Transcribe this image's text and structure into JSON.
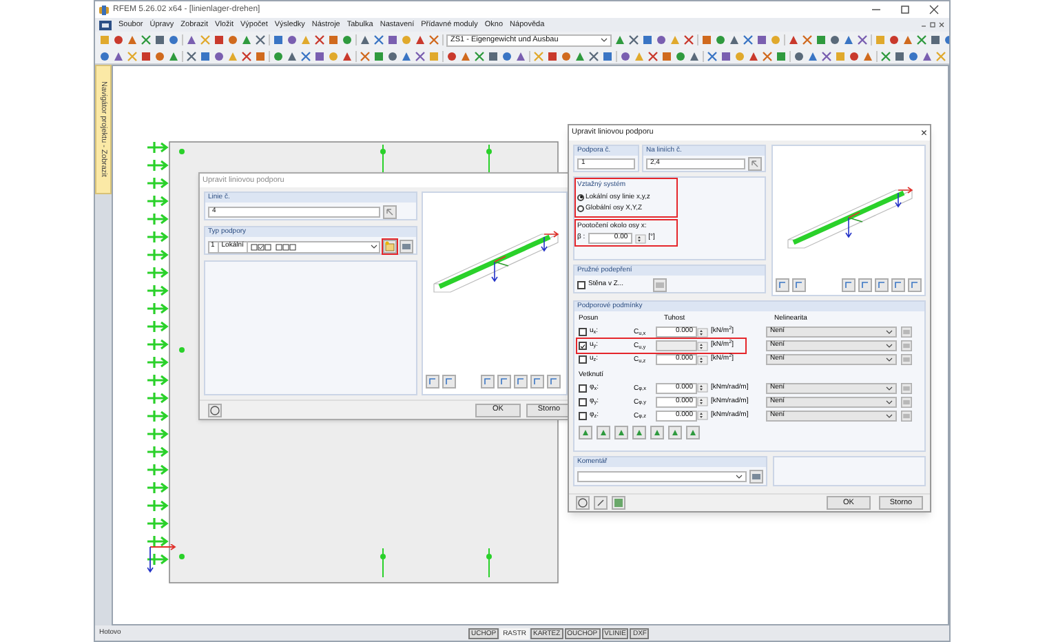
{
  "window": {
    "title": "RFEM 5.26.02 x64 - [linienlager-drehen]"
  },
  "menu": [
    "Soubor",
    "Úpravy",
    "Zobrazit",
    "Vložit",
    "Výpočet",
    "Výsledky",
    "Nástroje",
    "Tabulka",
    "Nastavení",
    "Přídavné moduly",
    "Okno",
    "Nápověda"
  ],
  "toolbar": {
    "load_case": "ZS1 - Eigengewicht und Ausbau"
  },
  "navigator_tab": {
    "label": "Navigátor projektu - Zobrazit"
  },
  "dialog_back": {
    "title": "Upravit liniovou podporu",
    "line_label": "Linie č.",
    "line_value": "4",
    "support_type_label": "Typ podpory",
    "support_number": "1",
    "support_system": "Lokální",
    "new_button_highlighted": true,
    "buttons": [
      "OK",
      "Storno"
    ]
  },
  "dialog_front": {
    "title": "Upravit liniovou podporu",
    "close": "×",
    "support_label": "Podpora č.",
    "support_value": "1",
    "lines_label": "Na liniích č.",
    "lines_value": "2,4",
    "reference": {
      "label": "Vztažný systém",
      "highlighted": true,
      "options": [
        {
          "label": "Lokální osy linie x,y,z",
          "selected": true
        },
        {
          "label": "Globální osy X,Y,Z",
          "selected": false
        }
      ]
    },
    "rotation": {
      "label": "Pootočení okolo osy x:",
      "symbol": "β :",
      "value": "0.00",
      "unit": "[°]",
      "highlighted": true
    },
    "elastic": {
      "label": "Pružné podepření",
      "checkbox": "Stěna v Z...",
      "checked": false
    },
    "conditions": {
      "label": "Podporové podmínky",
      "col_1": "Posun",
      "col_2": "Tuhost",
      "col_3": "Nelinearita",
      "translation": [
        {
          "label": "u$_{x}$:",
          "coef": "C$_{u,x}$",
          "value": "0.000",
          "unit": "[kN/m$^{2}$]",
          "nonlinearity": "Není",
          "checked": false,
          "highlighted": false
        },
        {
          "label": "u$_{y}$:",
          "coef": "C$_{u,y}$",
          "unit": "[kN/m$^{2}$]",
          "nonlinearity": "Není",
          "checked": true,
          "highlighted": true
        },
        {
          "label": "u$_{z}$:",
          "coef": "C$_{u,z}$",
          "value": "0.000",
          "unit": "[kN/m$^{2}$]",
          "nonlinearity": "Není",
          "checked": false,
          "highlighted": false
        }
      ],
      "rotation_label": "Vetknutí",
      "rotation": [
        {
          "label": "φ$_{x}$:",
          "coef": "C$_{φ,x}$",
          "value": "0.000",
          "unit": "[kNm/rad/m]",
          "nonlinearity": "Není",
          "checked": false,
          "highlighted": false
        },
        {
          "label": "φ$_{y}$:",
          "coef": "C$_{φ,y}$",
          "value": "0.000",
          "unit": "[kNm/rad/m]",
          "nonlinearity": "Není",
          "checked": false,
          "highlighted": false
        },
        {
          "label": "φ$_{z}$:",
          "coef": "C$_{φ,z}$",
          "value": "0.000",
          "unit": "[kNm/rad/m]",
          "nonlinearity": "Není",
          "checked": false,
          "highlighted": false
        }
      ]
    },
    "comment_label": "Komentář",
    "buttons": [
      "OK",
      "Storno"
    ]
  },
  "status_bar": {
    "text": "Hotovo",
    "toggles": [
      {
        "label": "UCHOP",
        "on": true
      },
      {
        "label": "RASTR",
        "on": false
      },
      {
        "label": "KARTEZ",
        "on": true
      },
      {
        "label": "OUCHOP",
        "on": true
      },
      {
        "label": "VLINIE",
        "on": true
      },
      {
        "label": "DXF",
        "on": true
      }
    ]
  }
}
